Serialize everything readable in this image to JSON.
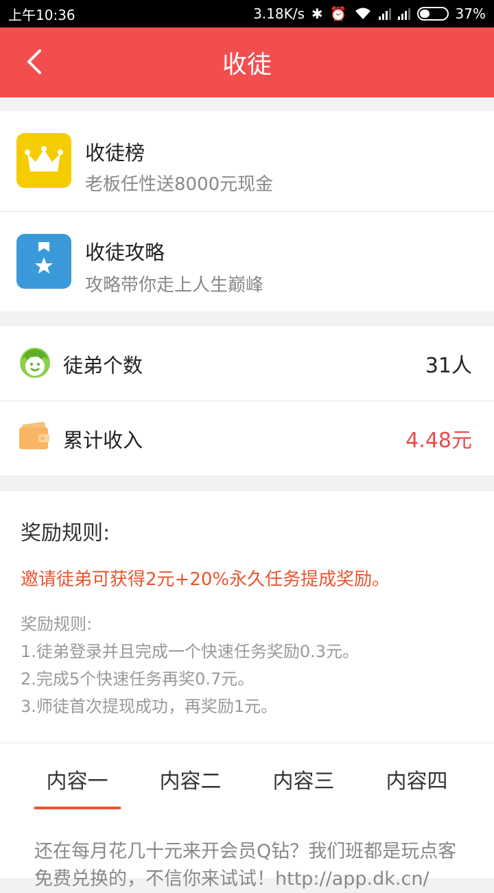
{
  "status_bar": {
    "time": "上午10:36",
    "network_speed": "3.18K/s",
    "battery": "37%"
  },
  "app_bar": {
    "title": "收徒"
  },
  "menu_items": [
    {
      "title": "收徒榜",
      "subtitle": "老板任性送8000元现金",
      "icon": "crown-icon",
      "color": "#f5cc00"
    },
    {
      "title": "收徒攻略",
      "subtitle": "攻略带你走上人生巅峰",
      "icon": "bookmark-star-icon",
      "color": "#3a9ad9"
    }
  ],
  "stats": {
    "apprentices_label": "徒弟个数",
    "apprentices_value": "31人",
    "income_label": "累计收入",
    "income_value": "4.48元",
    "income_color": "#e84a4a"
  },
  "rules": {
    "title": "奖励规则:",
    "highlight": "邀请徒弟可获得2元+20%永久任务提成奖励。",
    "subtitle": "奖励规则:",
    "lines": [
      "1.徒弟登录并且完成一个快速任务奖励0.3元。",
      "2.完成5个快速任务再奖0.7元。",
      "3.师徒首次提现成功，再奖励1元。"
    ]
  },
  "tabs": [
    "内容一",
    "内容二",
    "内容三",
    "内容四"
  ],
  "content": {
    "line1": "还在每月花几十元来开会员Q钻？我们班都是玩点客",
    "line2": "免费兑换的，不信你来试试！http://app.dk.cn/"
  },
  "accent_color": "#f24e4e"
}
